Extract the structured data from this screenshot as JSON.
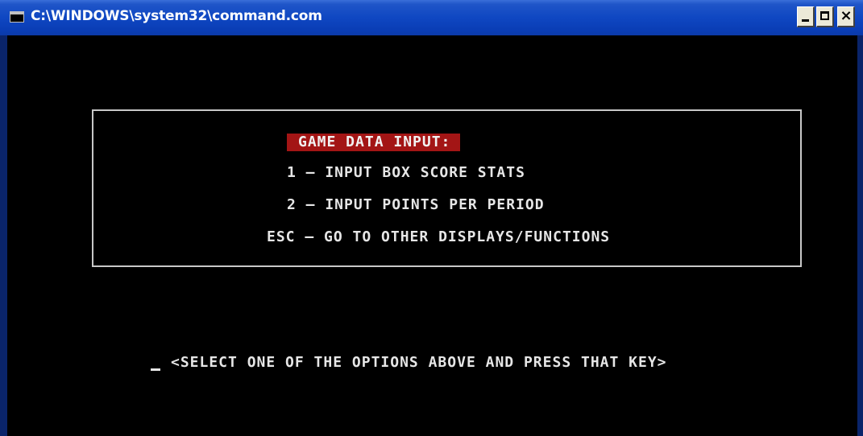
{
  "window": {
    "title": "C:\\WINDOWS\\system32\\command.com",
    "icon_label": "C:\\",
    "controls": {
      "minimize": "minimize",
      "maximize": "maximize",
      "close": "×"
    }
  },
  "console": {
    "menu": {
      "heading": "GAME DATA INPUT:",
      "options": [
        "1 – INPUT BOX SCORE STATS",
        "2 – INPUT POINTS PER PERIOD",
        "ESC – GO TO OTHER DISPLAYS/FUNCTIONS"
      ]
    },
    "prompt": "<SELECT ONE OF THE OPTIONS ABOVE AND PRESS THAT KEY>"
  },
  "colors": {
    "titlebar": "#0a3db5",
    "console_bg": "#000000",
    "console_text": "#e6e6e6",
    "heading_bg": "#a31515",
    "box_border": "#c8c8c8"
  },
  "icons": [
    "command-prompt-icon",
    "minimize-icon",
    "maximize-icon",
    "close-icon"
  ]
}
